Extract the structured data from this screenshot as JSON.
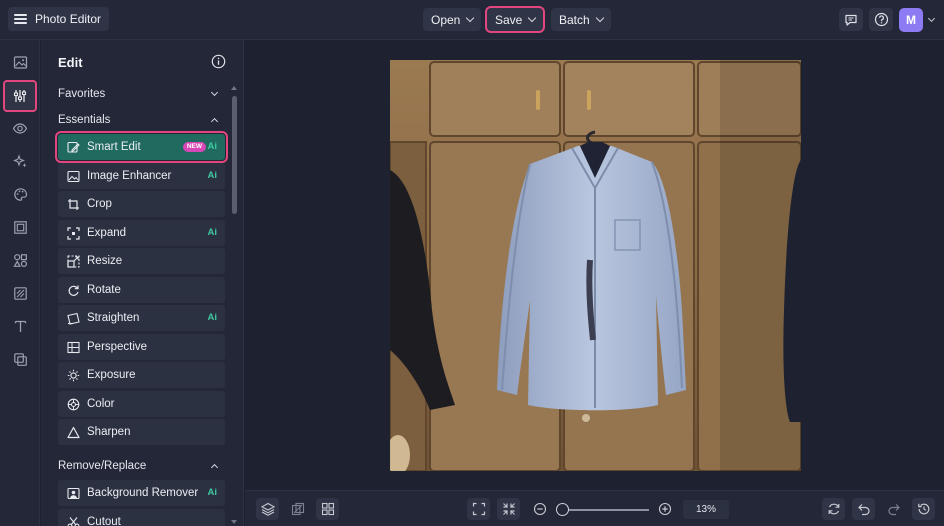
{
  "header": {
    "app_title": "Photo Editor",
    "menus": [
      {
        "label": "Open"
      },
      {
        "label": "Save"
      },
      {
        "label": "Batch"
      }
    ],
    "avatar_initial": "M"
  },
  "panel": {
    "title": "Edit",
    "sections": {
      "favorites": "Favorites",
      "essentials": "Essentials",
      "remove_replace": "Remove/Replace"
    },
    "tools": [
      {
        "label": "Smart Edit",
        "badge": "NEW",
        "ai": "Ai"
      },
      {
        "label": "Image Enhancer",
        "ai": "Ai"
      },
      {
        "label": "Crop"
      },
      {
        "label": "Expand",
        "ai": "Ai"
      },
      {
        "label": "Resize"
      },
      {
        "label": "Rotate"
      },
      {
        "label": "Straighten",
        "ai": "Ai"
      },
      {
        "label": "Perspective"
      },
      {
        "label": "Exposure"
      },
      {
        "label": "Color"
      },
      {
        "label": "Sharpen"
      }
    ],
    "remove_tools": [
      {
        "label": "Background Remover",
        "ai": "Ai"
      },
      {
        "label": "Cutout"
      }
    ]
  },
  "bottombar": {
    "zoom": "13%"
  },
  "colors": {
    "accent_highlight": "#e2467f",
    "active_tool_bg": "#206a60",
    "ai_label": "#3fc9a1",
    "new_badge": "#d847b6",
    "avatar_bg": "#8c7bf2"
  }
}
